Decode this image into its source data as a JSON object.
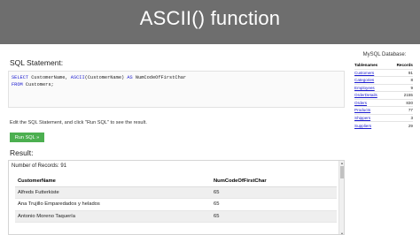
{
  "banner": {
    "title": "ASCII() function"
  },
  "sql_section": {
    "label": "SQL Statement:",
    "lines": [
      {
        "kw1": "SELECT",
        "text1": " CustomerName, ",
        "kw2": "ASCII",
        "text2": "(CustomerName) ",
        "kw3": "AS",
        "text3": " NumCodeOfFirstChar"
      },
      {
        "kw1": "FROM",
        "text1": " Customers;"
      }
    ]
  },
  "hint": "Edit the SQL Statement, and click \"Run SQL\" to see the result.",
  "run_button": {
    "label": "Run SQL »"
  },
  "result": {
    "label": "Result:",
    "record_count": "Number of Records: 91",
    "headers": [
      "CustomerName",
      "NumCodeOfFirstChar"
    ],
    "rows": [
      [
        "Alfreds Futterkiste",
        "65"
      ],
      [
        "Ana Trujillo Emparedados y helados",
        "65"
      ],
      [
        "Antonio Moreno Taquería",
        "65"
      ]
    ]
  },
  "sidebar": {
    "title": "MySQL Database:",
    "headers": [
      "Tablenames",
      "Records"
    ],
    "tables": [
      {
        "name": "Customers",
        "records": "91"
      },
      {
        "name": "Categories",
        "records": "8"
      },
      {
        "name": "Employees",
        "records": "9"
      },
      {
        "name": "OrderDetails",
        "records": "2155"
      },
      {
        "name": "Orders",
        "records": "830"
      },
      {
        "name": "Products",
        "records": "77"
      },
      {
        "name": "Shippers",
        "records": "3"
      },
      {
        "name": "Suppliers",
        "records": "29"
      }
    ]
  },
  "colors": {
    "banner_bg": "#6e6e6e",
    "button_green": "#4caf50",
    "keyword_blue": "#1a1ad0",
    "link_blue": "#1a1ad0"
  }
}
